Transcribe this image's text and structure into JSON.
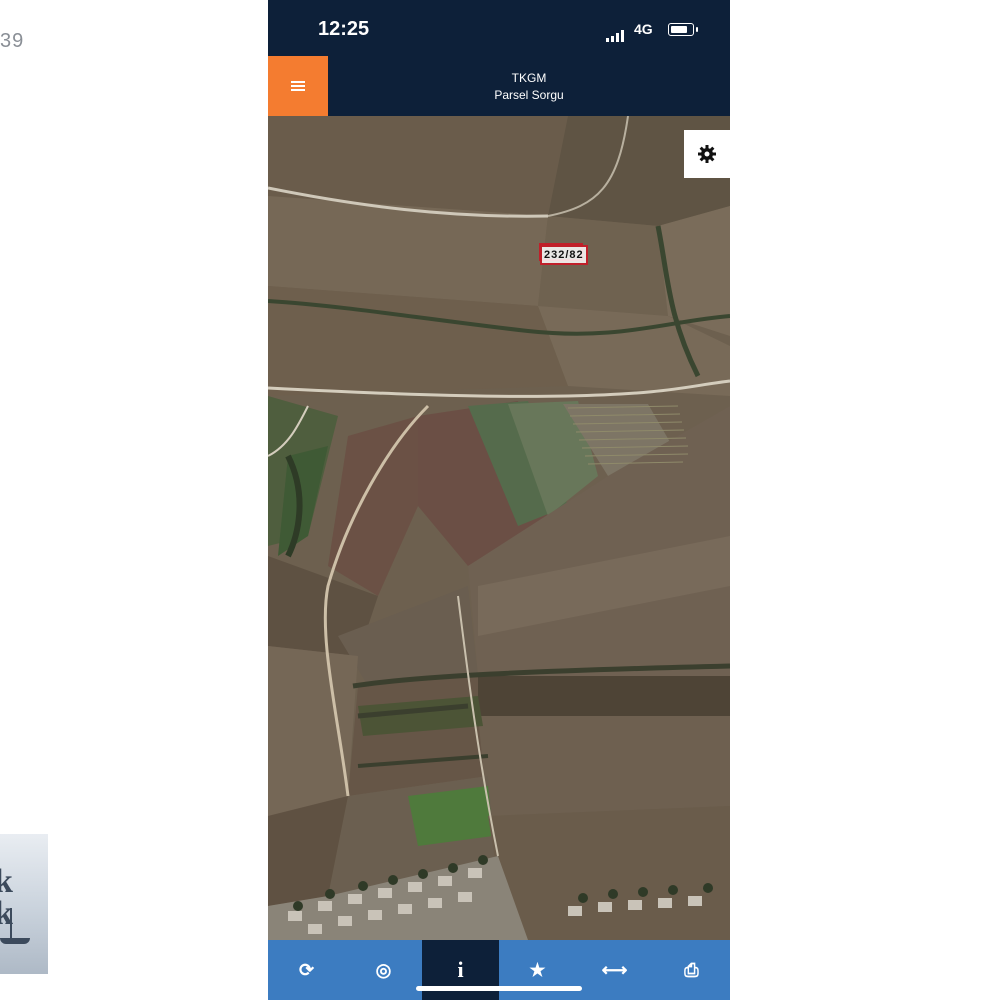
{
  "page": {
    "corner_text": "39"
  },
  "status_bar": {
    "time": "12:25",
    "network": "4G"
  },
  "header": {
    "title": "TKGM",
    "subtitle": "Parsel Sorgu"
  },
  "map": {
    "parcel_label": "232/82"
  },
  "icons": {
    "menu": "hamburger-icon",
    "settings": "gear-icon",
    "refresh": "refresh-icon",
    "locate": "locate-icon",
    "info": "info-icon",
    "favorite": "star-icon",
    "measure": "ruler-icon",
    "print": "printer-icon"
  },
  "bottom_bar": {
    "tabs": [
      {
        "icon": "refresh-icon",
        "glyph": "⟳"
      },
      {
        "icon": "locate-icon",
        "glyph": "◎"
      },
      {
        "icon": "info-icon",
        "glyph": "i"
      },
      {
        "icon": "star-icon",
        "glyph": "★"
      },
      {
        "icon": "ruler-icon",
        "glyph": "⟷"
      },
      {
        "icon": "printer-icon",
        "glyph": "⎙"
      }
    ],
    "active_index": 2
  },
  "colors": {
    "header_bg": "#0d2039",
    "menu_accent": "#f47c30",
    "bottom_bar": "#3c7cc1",
    "parcel_outline": "#c0202a"
  }
}
